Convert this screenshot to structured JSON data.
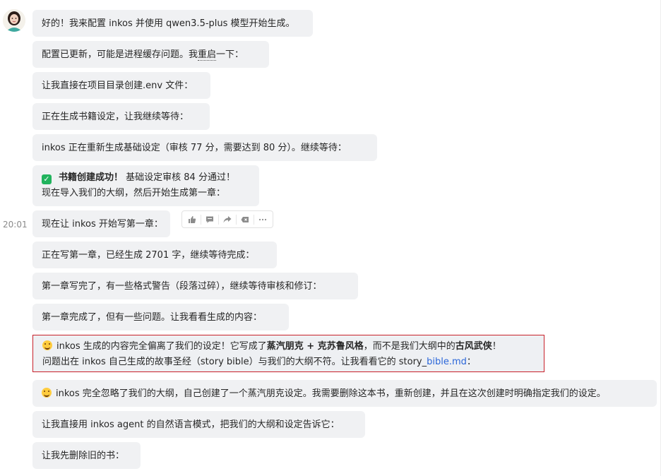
{
  "chat": {
    "timestamp": "20:01",
    "messages": [
      {
        "text": "好的！我来配置 inkos 并使用 qwen3.5-plus 模型开始生成。"
      },
      {
        "text_a": "配置已更新，可能是进程缓存问题。我",
        "text_b": "重启",
        "text_c": "一下："
      },
      {
        "text": "让我直接在项目目录创建.env 文件："
      },
      {
        "text": "正在生成书籍设定，让我继续等待："
      },
      {
        "text": "inkos 正在重新生成基础设定（审核 77 分，需要达到 80 分）。继续等待："
      },
      {
        "bold": "书籍创建成功！",
        "rest": " 基础设定审核 84 分通过！",
        "line2": "现在导入我们的大纲，然后开始生成第一章："
      },
      {
        "text": "现在让 inkos 开始写第一章："
      },
      {
        "text": "正在写第一章，已经生成 2701 字，继续等待完成："
      },
      {
        "text": "第一章写完了，有一些格式警告（段落过碎），继续等待审核和修订："
      },
      {
        "text": "第一章完成了，但有一些问题。让我看看生成的内容："
      },
      {
        "l1_a": "inkos 生成的内容完全偏离了我们的设定！它写成了",
        "l1_b": "蒸汽朋克 + 克苏鲁风格",
        "l1_c": "，而不是我们大纲中的",
        "l1_d": "古风武侠",
        "l1_e": "！",
        "l2_a": "问题出在 inkos 自己生成的故事圣经（story bible）与我们的大纲不符。让我看看它的 story_",
        "l2_link": "bible.md",
        "l2_c": "："
      },
      {
        "text": "inkos 完全忽略了我们的大纲，自己创建了一个蒸汽朋克设定。我需要删除这本书，重新创建，并且在这次创建时明确指定我们的设定。"
      },
      {
        "text": "让我直接用 inkos agent 的自然语言模式，把我们的大纲和设定告诉它："
      },
      {
        "text": "让我先删除旧的书："
      }
    ]
  },
  "toolbar": {
    "icons": [
      "thumbs-up-icon",
      "comment-icon",
      "share-icon",
      "delete-icon",
      "more-icon"
    ]
  },
  "colors": {
    "bubble": "#f0f1f3",
    "highlight_border": "#c8202a",
    "link": "#2a66d9",
    "check": "#21b35d"
  }
}
